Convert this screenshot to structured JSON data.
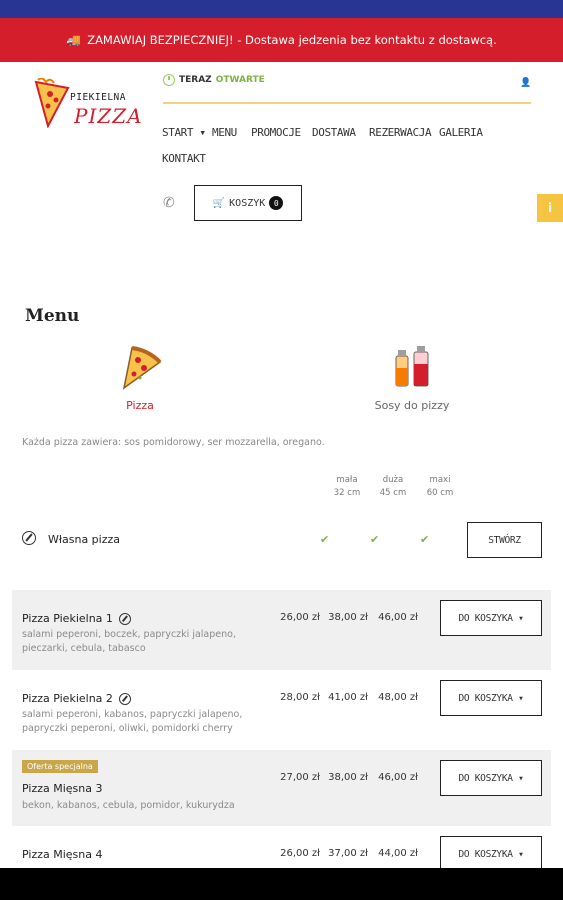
{
  "promo": {
    "icon": "truck-icon",
    "text": "ZAMAWIAJ BEZPIECZNIEJ! - Dostawa jedzenia bez kontaktu z dostawcą."
  },
  "logo": {
    "line1": "PIEKIELNA",
    "line2": "PIZZA"
  },
  "status": {
    "prefix": "TERAZ",
    "state": "OTWARTE"
  },
  "nav": [
    "START ▾",
    "MENU",
    "PROMOCJE",
    "DOSTAWA",
    "REZERWACJA",
    "GALERIA",
    "KONTAKT"
  ],
  "cart": {
    "label": "KOSZYK",
    "count": "0"
  },
  "side_tab": "i",
  "section_title": "Menu",
  "categories": [
    {
      "label": "Pizza",
      "icon": "pizza-slice-icon"
    },
    {
      "label": "Sosy do pizzy",
      "icon": "sauce-bottles-icon"
    }
  ],
  "info": "Każda pizza zawiera: sos pomidorowy, ser mozzarella, oregano.",
  "sizes": [
    {
      "name": "mała",
      "size": "32 cm"
    },
    {
      "name": "duża",
      "size": "45 cm"
    },
    {
      "name": "maxi",
      "size": "60 cm"
    }
  ],
  "custom_pizza": {
    "name": "Własna pizza",
    "button": "STWÓRZ"
  },
  "items": [
    {
      "name": "Pizza Piekielna 1",
      "desc": "salami peperoni, boczek, papryczki jalapeno, pieczarki, cebula, tabasco",
      "prices": [
        "26,00 zł",
        "38,00 zł",
        "46,00 zł"
      ],
      "button": "DO KOSZYKA ▾"
    },
    {
      "name": "Pizza Piekielna 2",
      "desc": "salami peperoni, kabanos, papryczki jalapeno, papryczki peperoni, oliwki, pomidorki cherry",
      "prices": [
        "28,00 zł",
        "41,00 zł",
        "48,00 zł"
      ],
      "button": "DO KOSZYKA ▾"
    },
    {
      "badge": "Oferta specjalna",
      "name": "Pizza Mięsna 3",
      "desc": "bekon, kabanos, cebula, pomidor, kukurydza",
      "prices": [
        "27,00 zł",
        "38,00 zł",
        "46,00 zł"
      ],
      "button": "DO KOSZYKA ▾"
    },
    {
      "name": "Pizza Mięsna 4",
      "prices": [
        "26,00 zł",
        "37,00 zł",
        "44,00 zł"
      ],
      "button": "DO KOSZYKA ▾"
    }
  ]
}
